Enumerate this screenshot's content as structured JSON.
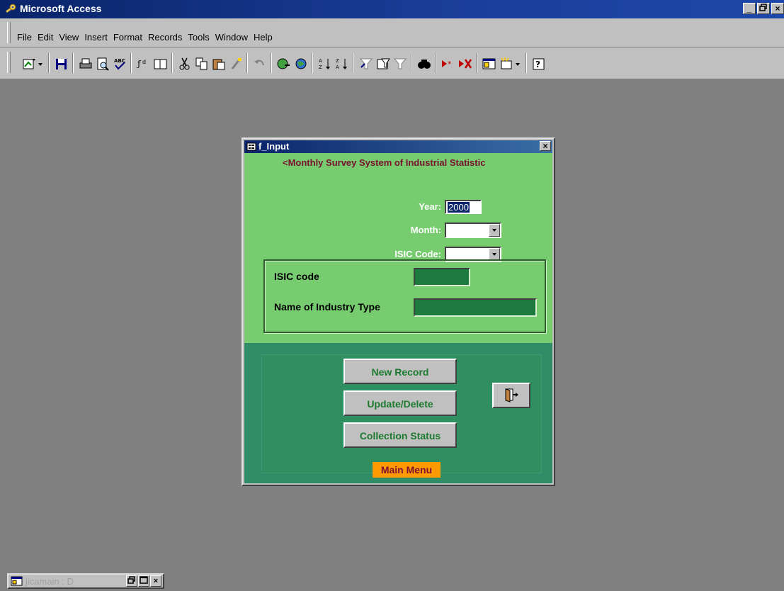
{
  "window": {
    "title": "Microsoft Access",
    "controls": [
      "_",
      "Ő",
      "×"
    ]
  },
  "menubar": {
    "items": [
      "File",
      "Edit",
      "View",
      "Insert",
      "Format",
      "Records",
      "Tools",
      "Window",
      "Help"
    ]
  },
  "toolbar": {
    "icons": [
      "design-view-icon",
      "save-icon",
      "print-icon",
      "print-preview-icon",
      "spelling-icon",
      "format-painter-icon",
      "insert-hyperlink-icon",
      "cut-icon",
      "copy-icon",
      "paste-icon",
      "brush-icon",
      "undo-icon",
      "web-icon",
      "web-toolbar-icon",
      "sort-ascending-icon",
      "sort-descending-icon",
      "filter-by-selection-icon",
      "filter-by-form-icon",
      "apply-filter-icon",
      "find-icon",
      "new-record-icon",
      "delete-record-icon",
      "database-window-icon",
      "new-object-icon",
      "help-icon"
    ]
  },
  "form": {
    "title": "f_Input",
    "close": "×",
    "subtitle": "<Monthly Survey System of Industrial Statistic",
    "year_label": "Year:",
    "year_value": "2000",
    "month_label": "Month:",
    "month_value": "",
    "isic_label": "ISIC Code:",
    "isic_value": "",
    "isic_code_label": "ISIC code",
    "industry_label": "Name of Industry Type",
    "buttons": {
      "new_record": "New Record",
      "update_delete": "Update/Delete",
      "collection_status": "Collection Status",
      "main_menu": "Main Menu"
    },
    "colors": {
      "body": "#77cc70",
      "footer": "#2f8c66",
      "field": "#1c7a3e",
      "main_menu_bg": "#ff9900"
    }
  },
  "minimized": {
    "title": "jicamain : D"
  }
}
